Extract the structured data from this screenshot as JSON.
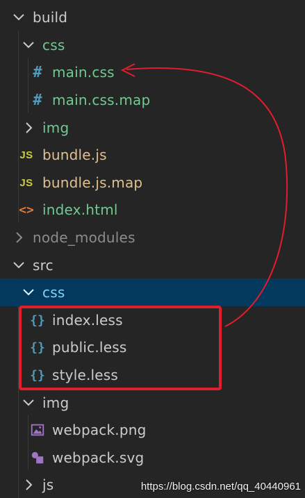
{
  "tree": {
    "build": {
      "label": "build",
      "expanded": true
    },
    "build_css": {
      "label": "css",
      "expanded": true
    },
    "main_css": {
      "label": "main.css",
      "icon": "css-hash-icon"
    },
    "main_css_map": {
      "label": "main.css.map",
      "icon": "css-hash-icon"
    },
    "build_img": {
      "label": "img",
      "expanded": false
    },
    "bundle_js": {
      "label": "bundle.js",
      "icon": "js-file-icon",
      "icon_text": "JS"
    },
    "bundle_js_map": {
      "label": "bundle.js.map",
      "icon": "js-file-icon",
      "icon_text": "JS"
    },
    "index_html": {
      "label": "index.html",
      "icon": "html-file-icon",
      "icon_text": "<>"
    },
    "node_modules": {
      "label": "node_modules",
      "expanded": false
    },
    "src": {
      "label": "src",
      "expanded": true
    },
    "src_css": {
      "label": "css",
      "expanded": true,
      "selected": true
    },
    "index_less": {
      "label": "index.less",
      "icon": "less-braces-icon",
      "icon_text": "{}"
    },
    "public_less": {
      "label": "public.less",
      "icon": "less-braces-icon",
      "icon_text": "{}"
    },
    "style_less": {
      "label": "style.less",
      "icon": "less-braces-icon",
      "icon_text": "{}"
    },
    "src_img": {
      "label": "img",
      "expanded": true
    },
    "webpack_png": {
      "label": "webpack.png",
      "icon": "image-file-icon"
    },
    "webpack_svg": {
      "label": "webpack.svg",
      "icon": "svg-file-icon"
    },
    "src_js": {
      "label": "js",
      "expanded": false
    }
  },
  "watermark": "https://blog.csdn.net/qq_40440961",
  "colors": {
    "background": "#252526",
    "selected_row": "#04395e",
    "annotation_red": "#e21d2c",
    "folder_text": "#cccccc",
    "modified_text": "#73c991",
    "js_text": "#e2c08d",
    "ignored_text": "#8c8c8c",
    "selected_text": "#7dd3ff"
  }
}
